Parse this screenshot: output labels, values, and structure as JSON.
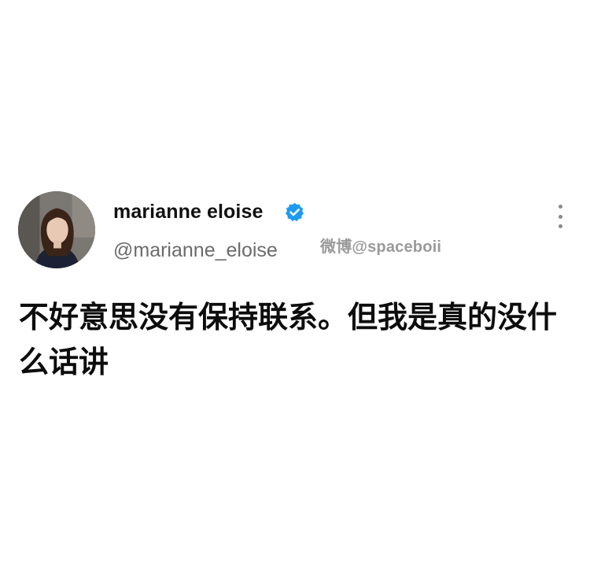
{
  "tweet": {
    "author": {
      "display_name": "marianne eloise",
      "handle": "@marianne_eloise",
      "verified": true,
      "verified_color": "#1d9bf0",
      "avatar_icon": "profile-photo"
    },
    "text": "不好意思没有保持联系。但我是真的没什么话讲",
    "more_icon": "vertical-ellipsis-icon"
  },
  "watermark": {
    "text": "微博@spaceboii"
  }
}
